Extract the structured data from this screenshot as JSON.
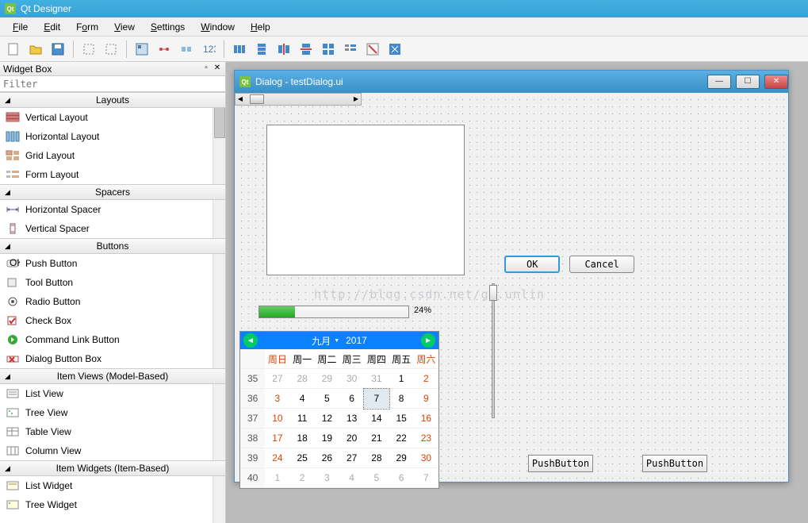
{
  "title": "Qt Designer",
  "menu": [
    "File",
    "Edit",
    "Form",
    "View",
    "Settings",
    "Window",
    "Help"
  ],
  "widgetbox": {
    "title": "Widget Box",
    "filter_placeholder": "Filter",
    "groups": [
      {
        "name": "Layouts",
        "items": [
          "Vertical Layout",
          "Horizontal Layout",
          "Grid Layout",
          "Form Layout"
        ]
      },
      {
        "name": "Spacers",
        "items": [
          "Horizontal Spacer",
          "Vertical Spacer"
        ]
      },
      {
        "name": "Buttons",
        "items": [
          "Push Button",
          "Tool Button",
          "Radio Button",
          "Check Box",
          "Command Link Button",
          "Dialog Button Box"
        ]
      },
      {
        "name": "Item Views (Model-Based)",
        "items": [
          "List View",
          "Tree View",
          "Table View",
          "Column View"
        ]
      },
      {
        "name": "Item Widgets (Item-Based)",
        "items": [
          "List Widget",
          "Tree Widget"
        ]
      }
    ]
  },
  "form": {
    "window_title": "Dialog - testDialog.ui",
    "ok_label": "OK",
    "cancel_label": "Cancel",
    "progress_pct": "24%",
    "pushbutton_label": "PushButton",
    "watermark": "http://blog.csdn.net/gu.unlin"
  },
  "calendar": {
    "month": "九月",
    "year": "2017",
    "day_headers": [
      "周日",
      "周一",
      "周二",
      "周三",
      "周四",
      "周五",
      "周六"
    ],
    "weeks": [
      {
        "wn": "35",
        "days": [
          {
            "d": "27",
            "g": true
          },
          {
            "d": "28",
            "g": true
          },
          {
            "d": "29",
            "g": true
          },
          {
            "d": "30",
            "g": true
          },
          {
            "d": "31",
            "g": true
          },
          {
            "d": "1"
          },
          {
            "d": "2",
            "we": true
          }
        ]
      },
      {
        "wn": "36",
        "days": [
          {
            "d": "3",
            "we": true
          },
          {
            "d": "4"
          },
          {
            "d": "5"
          },
          {
            "d": "6"
          },
          {
            "d": "7",
            "sel": true
          },
          {
            "d": "8"
          },
          {
            "d": "9",
            "we": true
          }
        ]
      },
      {
        "wn": "37",
        "days": [
          {
            "d": "10",
            "we": true
          },
          {
            "d": "11"
          },
          {
            "d": "12"
          },
          {
            "d": "13"
          },
          {
            "d": "14"
          },
          {
            "d": "15"
          },
          {
            "d": "16",
            "we": true
          }
        ]
      },
      {
        "wn": "38",
        "days": [
          {
            "d": "17",
            "we": true
          },
          {
            "d": "18"
          },
          {
            "d": "19"
          },
          {
            "d": "20"
          },
          {
            "d": "21"
          },
          {
            "d": "22"
          },
          {
            "d": "23",
            "we": true
          }
        ]
      },
      {
        "wn": "39",
        "days": [
          {
            "d": "24",
            "we": true
          },
          {
            "d": "25"
          },
          {
            "d": "26"
          },
          {
            "d": "27"
          },
          {
            "d": "28"
          },
          {
            "d": "29"
          },
          {
            "d": "30",
            "we": true
          }
        ]
      },
      {
        "wn": "40",
        "days": [
          {
            "d": "1",
            "g": true
          },
          {
            "d": "2",
            "g": true
          },
          {
            "d": "3",
            "g": true
          },
          {
            "d": "4",
            "g": true
          },
          {
            "d": "5",
            "g": true
          },
          {
            "d": "6",
            "g": true
          },
          {
            "d": "7",
            "g": true
          }
        ]
      }
    ]
  }
}
